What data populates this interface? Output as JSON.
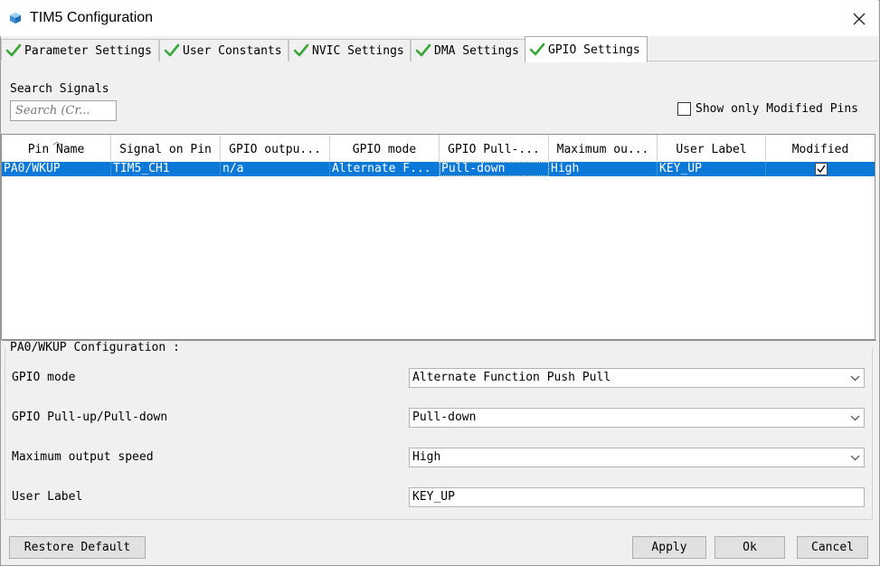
{
  "window": {
    "title": "TIM5 Configuration",
    "close_glyph": "✕"
  },
  "tabs": [
    {
      "label": "Parameter Settings",
      "active": false
    },
    {
      "label": "User Constants",
      "active": false
    },
    {
      "label": "NVIC Settings",
      "active": false
    },
    {
      "label": "DMA Settings",
      "active": false
    },
    {
      "label": "GPIO Settings",
      "active": true
    }
  ],
  "search": {
    "label": "Search Signals",
    "placeholder": "Search (Cr..."
  },
  "show_only_modified": {
    "label": "Show only Modified Pins",
    "checked": false
  },
  "table": {
    "columns": [
      "Pin Name",
      "Signal on Pin",
      "GPIO outpu...",
      "GPIO mode",
      "GPIO Pull-...",
      "Maximum ou...",
      "User Label",
      "Modified"
    ],
    "rows": [
      {
        "pin_name": "PA0/WKUP",
        "signal": "TIM5_CH1",
        "gpio_output": "n/a",
        "gpio_mode": "Alternate F...",
        "gpio_pull": "Pull-down",
        "max_speed": "High",
        "user_label": "KEY_UP",
        "modified": true
      }
    ]
  },
  "config": {
    "title": "PA0/WKUP Configuration :",
    "gpio_mode_label": "GPIO mode",
    "gpio_mode_value": "Alternate Function Push Pull",
    "pull_label": "GPIO Pull-up/Pull-down",
    "pull_value": "Pull-down",
    "speed_label": "Maximum output speed",
    "speed_value": "High",
    "user_label_label": "User Label",
    "user_label_value": "KEY_UP"
  },
  "buttons": {
    "restore": "Restore Default",
    "apply": "Apply",
    "ok": "Ok",
    "cancel": "Cancel"
  },
  "colors": {
    "selection": "#0a78d7",
    "check_green": "#3aa637"
  }
}
